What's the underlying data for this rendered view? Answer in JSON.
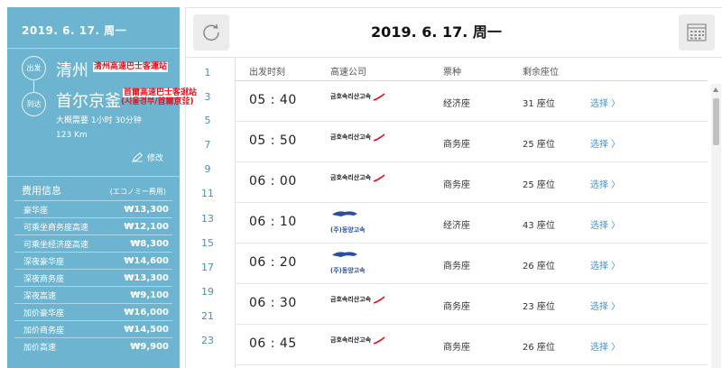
{
  "summary": {
    "date": "2019. 6. 17. 周一",
    "departure": {
      "badge": "出发",
      "city": "清州",
      "terminal": "清州高速巴士客運站"
    },
    "arrival": {
      "badge": "到达",
      "city": "首尔京釜",
      "terminal_line1": "首爾高速巴士客運站",
      "terminal_line2": "(시울경부/首爾京釜)"
    },
    "duration": "大概需要 1小时 30分钟",
    "distance": "123 Km",
    "edit_label": "修改"
  },
  "fees": {
    "title": "费用信息",
    "subtitle": "(エコノミー费用)",
    "items": [
      {
        "name": "豪华座",
        "price": "₩13,300"
      },
      {
        "name": "可乘坐商务座高速",
        "price": "₩12,100"
      },
      {
        "name": "可乘坐经济座高速",
        "price": "₩8,300"
      },
      {
        "name": "深夜豪华座",
        "price": "₩14,600"
      },
      {
        "name": "深夜商务座",
        "price": "₩13,300"
      },
      {
        "name": "深夜高速",
        "price": "₩9,100"
      },
      {
        "name": "加价豪华座",
        "price": "₩16,000"
      },
      {
        "name": "加价商务座",
        "price": "₩14,500"
      },
      {
        "name": "加价高速",
        "price": "₩9,900"
      }
    ]
  },
  "schedule": {
    "title": "2019. 6. 17. 周一",
    "line_numbers": [
      "1",
      "3",
      "5",
      "7",
      "9",
      "11",
      "13",
      "15",
      "17",
      "19",
      "21",
      "23"
    ],
    "columns": {
      "time": "出发时刻",
      "company": "高速公司",
      "grade": "票种",
      "seats": "剩余座位"
    },
    "rows": [
      {
        "time": "05 : 40",
        "company": "금호속리산고속",
        "grade": "经济座",
        "seats": "31 座位",
        "action": "选择 〉"
      },
      {
        "time": "05 : 50",
        "company": "금호속리산고속",
        "grade": "商务座",
        "seats": "25 座位",
        "action": "选择 〉"
      },
      {
        "time": "06 : 00",
        "company": "금호속리산고속",
        "grade": "商务座",
        "seats": "25 座位",
        "action": "选择 〉"
      },
      {
        "time": "06 : 10",
        "company": "(주)동양고속",
        "grade": "经济座",
        "seats": "43 座位",
        "action": "选择 〉"
      },
      {
        "time": "06 : 20",
        "company": "(주)동양고속",
        "grade": "商务座",
        "seats": "26 座位",
        "action": "选择 〉"
      },
      {
        "time": "06 : 30",
        "company": "금호속리산고속",
        "grade": "商务座",
        "seats": "23 座位",
        "action": "选择 〉"
      },
      {
        "time": "06 : 45",
        "company": "금호속리산고속",
        "grade": "商务座",
        "seats": "26 座位",
        "action": "选择 〉"
      }
    ]
  },
  "colors": {
    "panel": "#6db4d1",
    "accent_red": "#e8101b",
    "link_blue": "#4a90c9"
  }
}
